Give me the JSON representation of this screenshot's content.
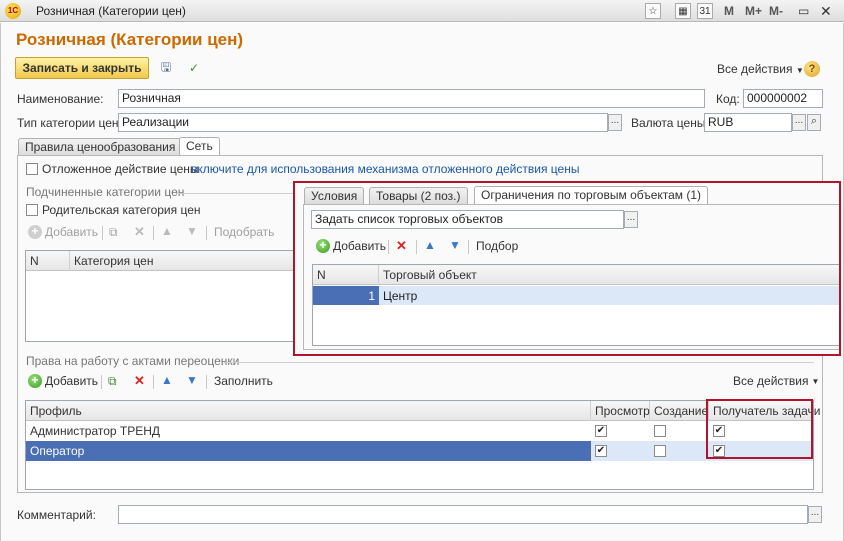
{
  "window": {
    "app_icon": "1С",
    "title": "Розничная (Категории цен)",
    "buttons": [
      "M",
      "M+",
      "M-"
    ]
  },
  "form": {
    "title": "Розничная (Категории цен)",
    "save_close_label": "Записать и закрыть",
    "all_actions_label": "Все действия",
    "help_label": "?"
  },
  "fields": {
    "name_label": "Наименование:",
    "name_value": "Розничная",
    "code_label": "Код:",
    "code_value": "000000002",
    "price_type_label": "Тип категории цен:",
    "price_type_value": "Реализации",
    "currency_label": "Валюта цены:",
    "currency_value": "RUB",
    "comment_label": "Комментарий:",
    "comment_value": "",
    "dots": "..."
  },
  "main_tabs": [
    "Правила ценообразования",
    "Сеть"
  ],
  "network": {
    "deferred_label": "Отложенное действие цены",
    "deferred_link": "включите для использования механизма отложенного действия цены",
    "subordinate_title": "Подчиненные категории цен",
    "parent_label": "Родительская категория цен",
    "sub_toolbar": {
      "add": "Добавить",
      "pick": "Подобрать"
    },
    "sub_columns": [
      "N",
      "Категория цен"
    ],
    "rights_title": "Права на работу с актами переоценки",
    "rights_toolbar": {
      "add": "Добавить",
      "fill": "Заполнить",
      "all_actions": "Все действия"
    },
    "rights_columns": [
      "Профиль",
      "Просмотр",
      "Создание",
      "Получатель задачи"
    ],
    "rights_rows": [
      {
        "profile": "Администратор ТРЕНД",
        "view": true,
        "create": false,
        "receiver": true
      },
      {
        "profile": "Оператор",
        "view": true,
        "create": false,
        "receiver": true
      }
    ]
  },
  "overlay": {
    "tabs": [
      "Условия",
      "Товары (2 поз.)",
      "Ограничения по торговым объектам (1)"
    ],
    "select_value": "Задать список торговых объектов",
    "toolbar": {
      "add": "Добавить",
      "pick": "Подбор"
    },
    "columns": [
      "N",
      "Торговый объект"
    ],
    "rows": [
      {
        "n": "1",
        "object": "Центр"
      }
    ]
  },
  "colors": {
    "accent_title": "#cc6a00",
    "highlight_red": "#b3142c",
    "selected_row": "#4a6fb5",
    "link": "#1a57a8"
  }
}
